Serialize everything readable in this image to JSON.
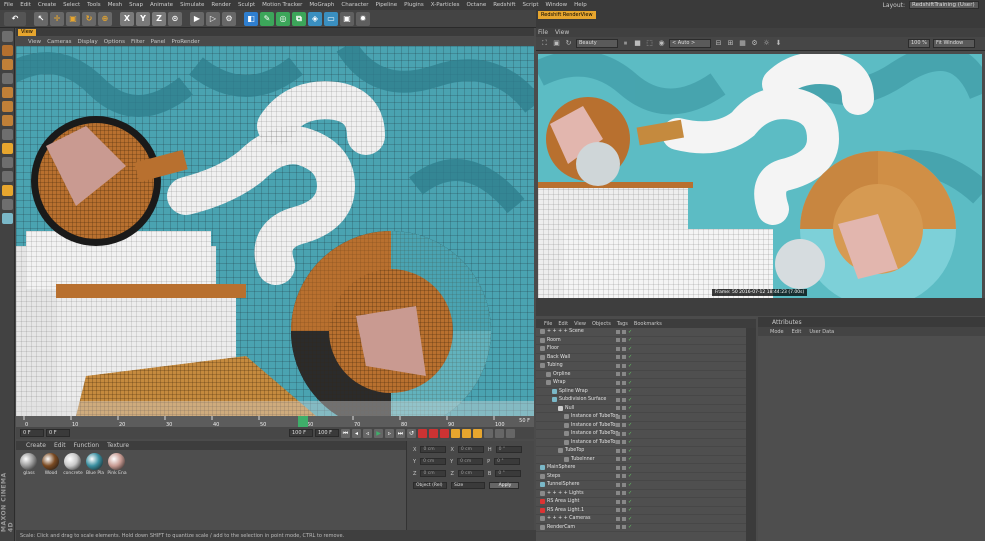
{
  "menubar": {
    "items": [
      "File",
      "Edit",
      "Create",
      "Select",
      "Tools",
      "Mesh",
      "Snap",
      "Animate",
      "Simulate",
      "Render",
      "Sculpt",
      "Motion Tracker",
      "MoGraph",
      "Character",
      "Pipeline",
      "Plugins",
      "X-Particles",
      "Octane",
      "Redshift",
      "Script",
      "Window",
      "Help"
    ],
    "layout_label": "Layout:",
    "layout_value": "RedshiftTraining (User)"
  },
  "toolbar": {
    "axis_x": "X",
    "axis_y": "Y",
    "axis_z": "Z"
  },
  "viewport": {
    "tab": "View",
    "menu": [
      "View",
      "Cameras",
      "Display",
      "Options",
      "Filter",
      "Panel",
      "ProRender"
    ]
  },
  "timeline": {
    "ticks": [
      "0",
      "10",
      "20",
      "30",
      "40",
      "50",
      "60",
      "70",
      "80",
      "90",
      "100"
    ],
    "end_frame": "50 F"
  },
  "transport": {
    "start": "0 F",
    "current": "0 F",
    "end": "100 F",
    "end2": "100 F"
  },
  "materials": {
    "menu": [
      "Create",
      "Edit",
      "Function",
      "Texture"
    ],
    "items": [
      {
        "label": "glass",
        "color": "#9a9a9a"
      },
      {
        "label": "Wood",
        "color": "#7a4a22"
      },
      {
        "label": "concrete",
        "color": "#c9c9c9"
      },
      {
        "label": "Blue Pla",
        "color": "#3a8fa0"
      },
      {
        "label": "Pink Ena",
        "color": "#c79a92"
      }
    ]
  },
  "coords": {
    "rows": [
      [
        "X",
        "0 cm",
        "X",
        "0 cm",
        "H",
        "0 °"
      ],
      [
        "Y",
        "0 cm",
        "Y",
        "0 cm",
        "P",
        "0 °"
      ],
      [
        "Z",
        "0 cm",
        "Z",
        "0 cm",
        "B",
        "0 °"
      ]
    ],
    "mode_a": "Object (Rel)",
    "mode_b": "Size",
    "apply": "Apply"
  },
  "statusbar": "Scale: Click and drag to scale elements. Hold down SHIFT to quantize scale / add to the selection in point mode, CTRL to remove.",
  "logo": "MAXON CINEMA 4D",
  "renderview": {
    "title": "Redshift RenderView",
    "menu": [
      "File",
      "View"
    ],
    "beauty": "Beauty",
    "auto": "< Auto >",
    "zoom": "100 %",
    "fit": "Fit Window",
    "frame_info": "Frame: 50   2016-07-12 18:44:23 (7.00s)"
  },
  "objects": {
    "menu": [
      "File",
      "Edit",
      "View",
      "Objects",
      "Tags",
      "Bookmarks"
    ],
    "rows": [
      {
        "label": "+ + + + Scene",
        "indent": 0,
        "color": "#8a8a8a"
      },
      {
        "label": "Room",
        "indent": 0,
        "color": "#8a8a8a"
      },
      {
        "label": "Floor",
        "indent": 0,
        "color": "#8a8a8a"
      },
      {
        "label": "Back Wall",
        "indent": 0,
        "color": "#8a8a8a"
      },
      {
        "label": "Tubing",
        "indent": 0,
        "color": "#8a8a8a"
      },
      {
        "label": "Orpline",
        "indent": 1,
        "color": "#8a8a8a"
      },
      {
        "label": "Wrap",
        "indent": 1,
        "color": "#8a8a8a"
      },
      {
        "label": "Spline Wrap",
        "indent": 2,
        "color": "#7ab8c8"
      },
      {
        "label": "Subdivision Surface",
        "indent": 2,
        "color": "#7ab8c8"
      },
      {
        "label": "Null",
        "indent": 3,
        "color": "#cccccc"
      },
      {
        "label": "Instance of TubeTop",
        "indent": 4,
        "color": "#8a8a8a"
      },
      {
        "label": "Instance of TubeTop",
        "indent": 4,
        "color": "#8a8a8a"
      },
      {
        "label": "Instance of TubeTop",
        "indent": 4,
        "color": "#8a8a8a"
      },
      {
        "label": "Instance of TubeTop",
        "indent": 4,
        "color": "#8a8a8a"
      },
      {
        "label": "TubeTop",
        "indent": 3,
        "color": "#8a8a8a"
      },
      {
        "label": "Tubelnner",
        "indent": 4,
        "color": "#8a8a8a"
      },
      {
        "label": "MainSphere",
        "indent": 0,
        "color": "#7ab8c8"
      },
      {
        "label": "Steps",
        "indent": 0,
        "color": "#8a8a8a"
      },
      {
        "label": "TunnelSphere",
        "indent": 0,
        "color": "#7ab8c8"
      },
      {
        "label": "+ + + + Lights",
        "indent": 0,
        "color": "#8a8a8a"
      },
      {
        "label": "RS Area Light",
        "indent": 0,
        "color": "#d33"
      },
      {
        "label": "RS Area Light.1",
        "indent": 0,
        "color": "#d33"
      },
      {
        "label": "+ + + + Cameras",
        "indent": 0,
        "color": "#8a8a8a"
      },
      {
        "label": "RenderCam",
        "indent": 0,
        "color": "#8a8a8a"
      }
    ]
  },
  "attributes": {
    "title": "Attributes",
    "menu": [
      "Mode",
      "Edit",
      "User Data"
    ]
  },
  "colors": {
    "accent": "#e7a62e",
    "wall": "#4aa3b1",
    "wood": "#b8702f"
  }
}
